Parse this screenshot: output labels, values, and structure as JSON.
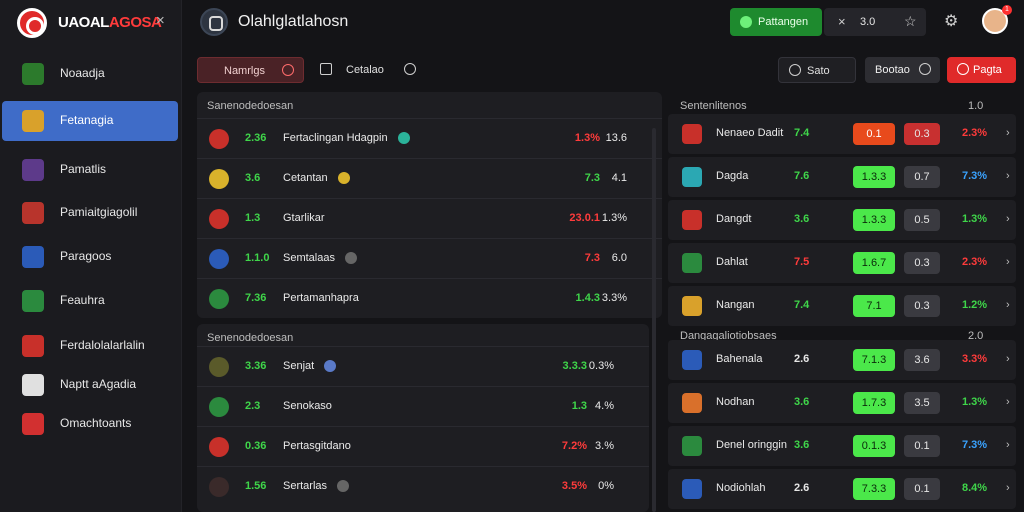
{
  "app": {
    "brand_main": "UAOAL",
    "brand_red": "AGOSA",
    "close": "×",
    "page_title": "Olahlglatlahosn"
  },
  "sidebar": {
    "items": [
      {
        "label": "Noaadja",
        "icon_color": "#2c7a2c",
        "active": false
      },
      {
        "label": "Fetanagia",
        "icon_color": "#d9a12b",
        "active": true
      },
      {
        "label": "Pamatlis",
        "icon_color": "#5d3a8a",
        "active": false
      },
      {
        "label": "Pamiaitgiagolil",
        "icon_color": "#b8342c",
        "active": false
      },
      {
        "label": "Paragoos",
        "icon_color": "#2b5bb8",
        "active": false
      },
      {
        "label": "Feauhra",
        "icon_color": "#2b8a3e",
        "active": false
      },
      {
        "label": "Ferdalolalarlalin",
        "icon_color": "#c8302a",
        "active": false
      },
      {
        "label": "Naptt aAgadia",
        "icon_color": "#e0e0e0",
        "active": false
      },
      {
        "label": "Omachtoants",
        "icon_color": "#d23030",
        "active": false
      }
    ]
  },
  "topbar": {
    "live_label": "Pattangen",
    "odds_x": "×",
    "odds_value": "3.0",
    "star": "☆",
    "gear": "⚙",
    "notification_count": "1"
  },
  "filters": {
    "markets": "Namrlgs",
    "events": "Cetalao",
    "save": "Sato",
    "boost": "Bootao",
    "place": "Pagta"
  },
  "left_panel_1": {
    "header": "Sanenodedoesan",
    "rows": [
      {
        "score": "2.36",
        "name": "Fertaclingan Hdagpin",
        "odd1": "1.3%",
        "odd1_color": "#ff3b3b",
        "odd2": "13.6",
        "icon": "#c8302a",
        "tag": "#2bb39a"
      },
      {
        "score": "3.6",
        "name": "Cetantan",
        "odd1": "7.3",
        "odd1_color": "#3fd64a",
        "odd2": "4.1",
        "icon": "#d9b22b",
        "tag": "#d9b22b"
      },
      {
        "score": "1.3",
        "name": "Gtarlikar",
        "odd1": "23.0.1",
        "odd1_color": "#ff3b3b",
        "odd2": "1.3%",
        "icon": "#c8302a",
        "tag": ""
      },
      {
        "score": "1.1.0",
        "name": "Semtalaas",
        "odd1": "7.3",
        "odd1_color": "#ff3b3b",
        "odd2": "6.0",
        "icon": "#2b5bb8",
        "tag": "#666"
      },
      {
        "score": "7.36",
        "name": "Pertamanhapra",
        "odd1": "1.4.3",
        "odd1_color": "#3fd64a",
        "odd2": "3.3%",
        "icon": "#2b8a3e",
        "tag": ""
      }
    ]
  },
  "left_panel_2": {
    "header": "Senenodedoesan",
    "rows": [
      {
        "score": "3.36",
        "name": "Senjat",
        "odd1": "3.3.3",
        "odd1_color": "#3fd64a",
        "odd2": "0.3%",
        "icon": "#5a5a2a",
        "tag": "#5a7ac8"
      },
      {
        "score": "2.3",
        "name": "Senokaso",
        "odd1": "1.3",
        "odd1_color": "#3fd64a",
        "odd2": "4.%",
        "icon": "#2b8a3e",
        "tag": ""
      },
      {
        "score": "0.36",
        "name": "Pertasgitdano",
        "odd1": "7.2%",
        "odd1_color": "#ff3b3b",
        "odd2": "3.%",
        "icon": "#c8302a",
        "tag": ""
      },
      {
        "score": "1.56",
        "name": "Sertarlas",
        "odd1": "3.5%",
        "odd1_color": "#ff3b3b",
        "odd2": "0%",
        "icon": "#3a2a2a",
        "tag": "#666"
      }
    ]
  },
  "right_panel_1": {
    "header": "Sentenlitenos",
    "count": "1.0",
    "rows": [
      {
        "name": "Nenaeo Dadit",
        "num": "7.4",
        "num_color": "#3fd64a",
        "odd_a": "0.1",
        "odd_a_bg": "#e84a1c",
        "odd_b": "0.3",
        "odd_b_bg": "#c83030",
        "pct": "2.3%",
        "pct_color": "#ff3b3b",
        "icon": "#c8302a"
      },
      {
        "name": "Dagda",
        "num": "7.6",
        "num_color": "#3fd64a",
        "odd_a": "1.3.3",
        "odd_a_bg": "#4be84a",
        "odd_b": "0.7",
        "odd_b_bg": "#3a3a40",
        "pct": "7.3%",
        "pct_color": "#3aa3ff",
        "icon": "#2ba8b3"
      },
      {
        "name": "Dangdt",
        "num": "3.6",
        "num_color": "#3fd64a",
        "odd_a": "1.3.3",
        "odd_a_bg": "#4be84a",
        "odd_b": "0.5",
        "odd_b_bg": "#3a3a40",
        "pct": "1.3%",
        "pct_color": "#3fd64a",
        "icon": "#c8302a"
      },
      {
        "name": "Dahlat",
        "num": "7.5",
        "num_color": "#ff3b3b",
        "odd_a": "1.6.7",
        "odd_a_bg": "#4be84a",
        "odd_b": "0.3",
        "odd_b_bg": "#3a3a40",
        "pct": "2.3%",
        "pct_color": "#ff3b3b",
        "icon": "#2b8a3e"
      },
      {
        "name": "Nangan",
        "num": "7.4",
        "num_color": "#3fd64a",
        "odd_a": "7.1",
        "odd_a_bg": "#4be84a",
        "odd_b": "0.3",
        "odd_b_bg": "#3a3a40",
        "pct": "1.2%",
        "pct_color": "#3fd64a",
        "icon": "#d9a12b"
      }
    ]
  },
  "right_panel_2": {
    "header": "Dangagaliotiobsaes",
    "count": "2.0",
    "rows": [
      {
        "name": "Bahenala",
        "num": "2.6",
        "num_color": "#e6e6e6",
        "odd_a": "7.1.3",
        "odd_a_bg": "#4be84a",
        "odd_b": "3.6",
        "odd_b_bg": "#3a3a40",
        "pct": "3.3%",
        "pct_color": "#ff3b3b",
        "icon": "#2b5bb8"
      },
      {
        "name": "Nodhan",
        "num": "3.6",
        "num_color": "#3fd64a",
        "odd_a": "1.7.3",
        "odd_a_bg": "#4be84a",
        "odd_b": "3.5",
        "odd_b_bg": "#3a3a40",
        "pct": "1.3%",
        "pct_color": "#3fd64a",
        "icon": "#d9702b"
      },
      {
        "name": "Denel oringgin",
        "num": "3.6",
        "num_color": "#3fd64a",
        "odd_a": "0.1.3",
        "odd_a_bg": "#4be84a",
        "odd_b": "0.1",
        "odd_b_bg": "#3a3a40",
        "pct": "7.3%",
        "pct_color": "#3aa3ff",
        "icon": "#2b8a3e"
      },
      {
        "name": "Nodiohlah",
        "num": "2.6",
        "num_color": "#e6e6e6",
        "odd_a": "7.3.3",
        "odd_a_bg": "#4be84a",
        "odd_b": "0.1",
        "odd_b_bg": "#3a3a40",
        "pct": "8.4%",
        "pct_color": "#3fd64a",
        "icon": "#2b5bb8"
      }
    ]
  }
}
